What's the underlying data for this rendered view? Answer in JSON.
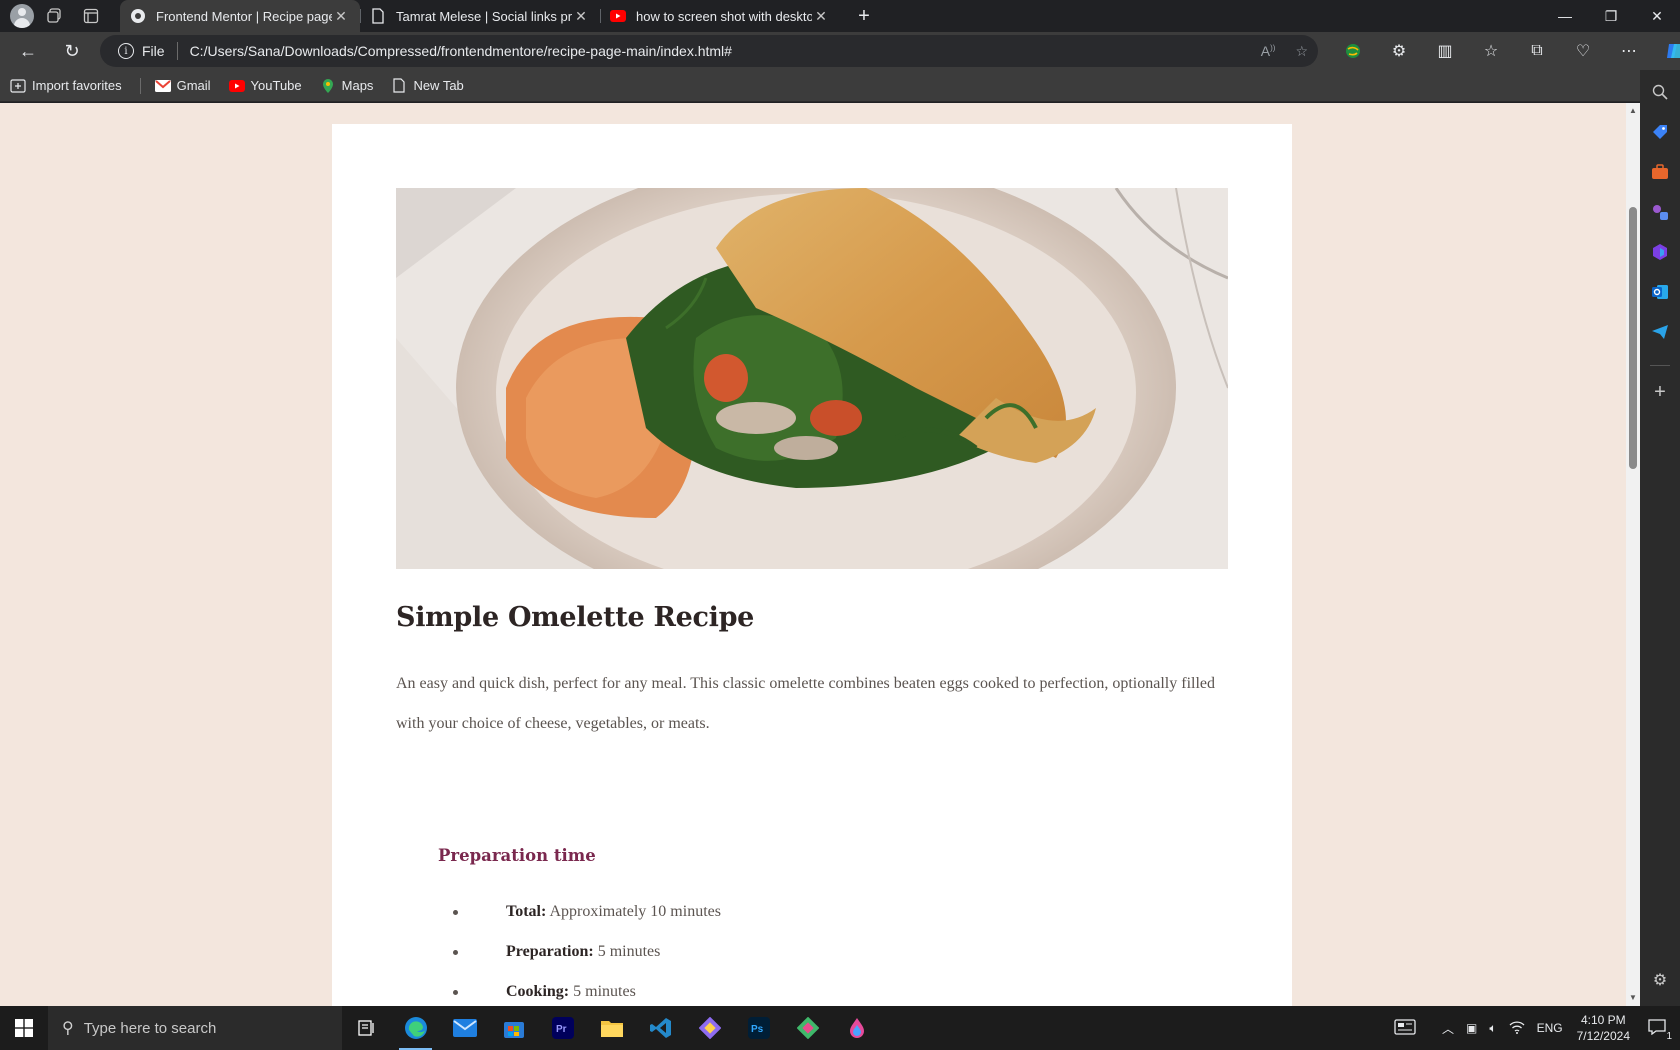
{
  "browser": {
    "tabs": [
      {
        "title": "Frontend Mentor | Recipe page",
        "active": true
      },
      {
        "title": "Tamrat Melese | Social links profil",
        "active": false
      },
      {
        "title": "how to screen shot with desktop",
        "active": false
      }
    ],
    "address": {
      "scheme_label": "File",
      "url": "C:/Users/Sana/Downloads/Compressed/frontendmentore/recipe-page-main/index.html#"
    },
    "favorites": [
      {
        "label": "Import favorites",
        "icon": "import-icon"
      },
      {
        "label": "Gmail",
        "icon": "gmail-icon"
      },
      {
        "label": "YouTube",
        "icon": "youtube-icon"
      },
      {
        "label": "Maps",
        "icon": "maps-icon"
      },
      {
        "label": "New Tab",
        "icon": "page-icon"
      }
    ]
  },
  "page": {
    "image_alt": "Omelette with spinach, mushrooms and herbs on a plate with hummus",
    "title": "Simple Omelette Recipe",
    "description": "An easy and quick dish, perfect for any meal. This classic omelette combines beaten eggs cooked to perfection, optionally filled with your choice of cheese, vegetables, or meats.",
    "preparation": {
      "heading": "Preparation time",
      "items": [
        {
          "label": "Total:",
          "value": "Approximately 10 minutes"
        },
        {
          "label": "Preparation:",
          "value": "5 minutes"
        },
        {
          "label": "Cooking:",
          "value": "5 minutes"
        }
      ]
    }
  },
  "taskbar": {
    "search_placeholder": "Type here to search",
    "language": "ENG",
    "time": "4:10 PM",
    "date": "7/12/2024",
    "notification_count": "1"
  },
  "colors": {
    "page_bg": "#f3e6dd",
    "accent": "#7a284e",
    "heading": "#2d2524",
    "body_text": "#5b5450"
  }
}
